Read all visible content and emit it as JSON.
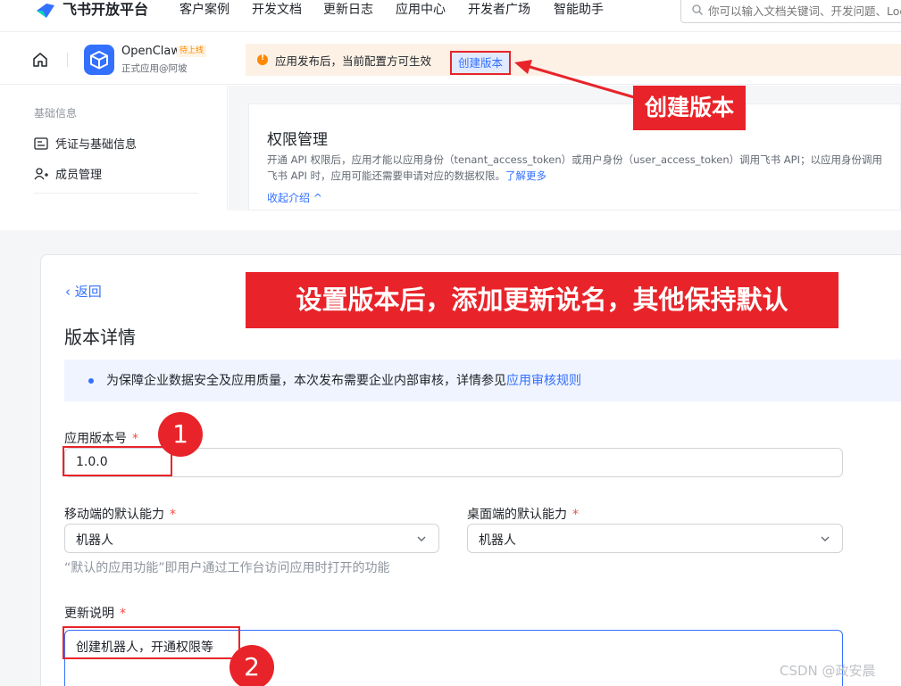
{
  "topnav": {
    "brand": "飞书开放平台",
    "items": [
      "客户案例",
      "开发文档",
      "更新日志",
      "应用中心",
      "开发者广场",
      "智能助手"
    ],
    "search_placeholder": "你可以输入文档关键词、开发问题、Log"
  },
  "app": {
    "name": "OpenClaw",
    "badge": "待上线",
    "subtitle": "正式应用@阿坡"
  },
  "notice": {
    "text": "应用发布后，当前配置方可生效",
    "create_button": "创建版本"
  },
  "sidebar": {
    "group": "基础信息",
    "items": [
      "凭证与基础信息",
      "成员管理"
    ]
  },
  "permission": {
    "title": "权限管理",
    "desc": "开通 API 权限后，应用才能以应用身份（tenant_access_token）或用户身份（user_access_token）调用飞书 API；以应用身份调用飞书 API 时，应用可能还需要申请对应的数据权限。",
    "more_link": "了解更多",
    "collapse": "收起介绍 ^"
  },
  "callouts": {
    "create_version": "创建版本",
    "instruction": "设置版本后，添加更新说名，其他保持默认"
  },
  "version_page": {
    "back": "‹ 返回",
    "title": "版本详情",
    "info": "为保障企业数据安全及应用质量，本次发布需要企业内部审核，详情参见",
    "info_link": "应用审核规则",
    "version_label": "应用版本号",
    "version_value": "1.0.0",
    "mobile_label": "移动端的默认能力",
    "mobile_value": "机器人",
    "desktop_label": "桌面端的默认能力",
    "desktop_value": "机器人",
    "hint": "“默认的应用功能”即用户通过工作台访问应用时打开的功能",
    "notes_label": "更新说明",
    "notes_value": "创建机器人，开通权限等",
    "required_mark": "*"
  },
  "badges": [
    "1",
    "2"
  ],
  "watermark": "CSDN @政安晨",
  "colors": {
    "accent": "#3370ff",
    "annotation_red": "#e8242a",
    "warning": "#ff8800"
  },
  "icons": [
    "brand-logo-icon",
    "search-icon",
    "home-icon",
    "app-icon",
    "warning-icon",
    "id-card-icon",
    "user-plus-icon",
    "chevron-down-icon"
  ]
}
